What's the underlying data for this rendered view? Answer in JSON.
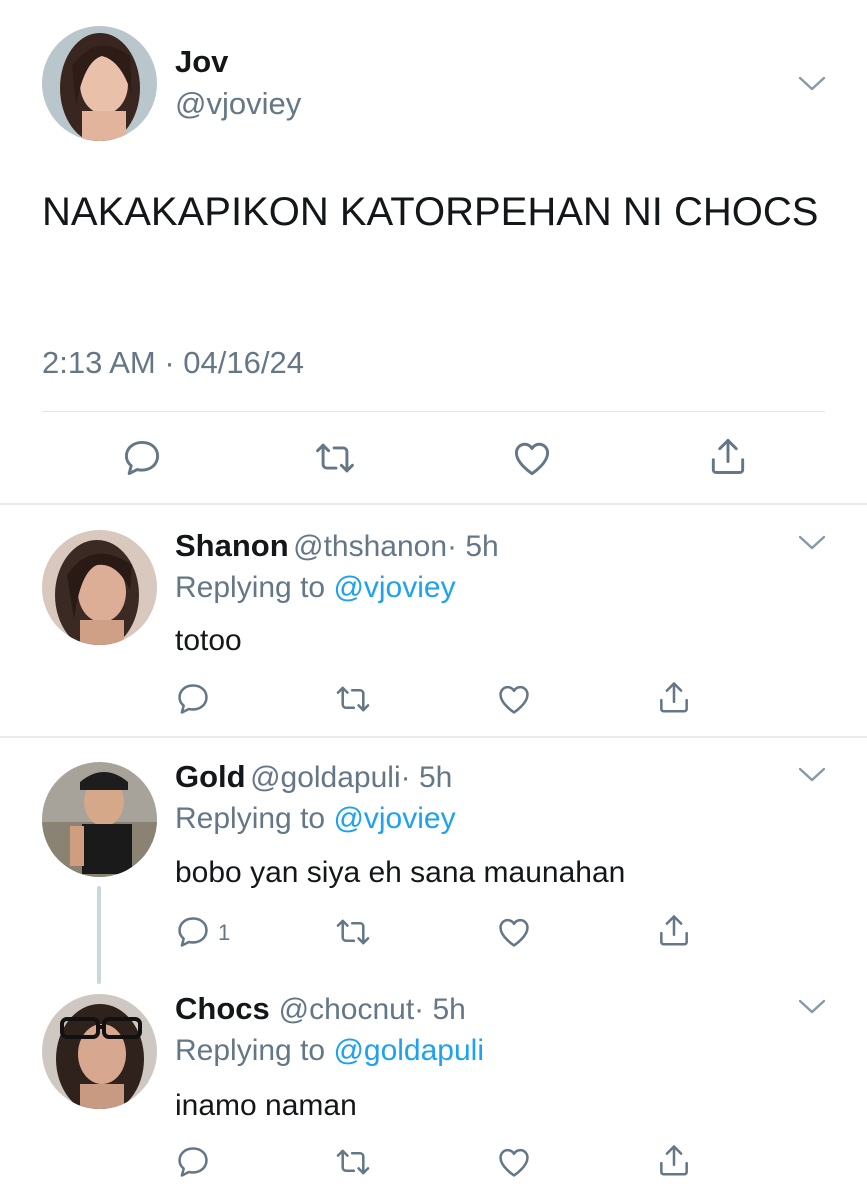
{
  "main_tweet": {
    "name": "Jov",
    "handle": "@vjoviey",
    "text": "NAKAKAPIKON KATORPEHAN NI CHOCS",
    "timestamp": "2:13 AM · 04/16/24"
  },
  "replies": [
    {
      "name": "Shanon",
      "handle": "@thshanon",
      "time": "· 5h",
      "replying_prefix": "Replying to ",
      "replying_to": "@vjoviey",
      "text": "totoo",
      "reply_count": ""
    },
    {
      "name": "Gold",
      "handle": "@goldapuli",
      "time": "· 5h",
      "replying_prefix": "Replying to ",
      "replying_to": "@vjoviey",
      "text": "bobo yan siya eh sana maunahan",
      "reply_count": "1"
    },
    {
      "name": "Chocs",
      "handle": "@chocnut",
      "time": "· 5h",
      "replying_prefix": "Replying to ",
      "replying_to": "@goldapuli",
      "text": "inamo naman",
      "reply_count": ""
    }
  ],
  "colors": {
    "text": "#14171a",
    "secondary": "#657786",
    "link": "#1da1f2",
    "divider": "#e1e8ed"
  },
  "icons": [
    "reply-icon",
    "retweet-icon",
    "like-icon",
    "share-icon",
    "chevron-down-icon"
  ]
}
